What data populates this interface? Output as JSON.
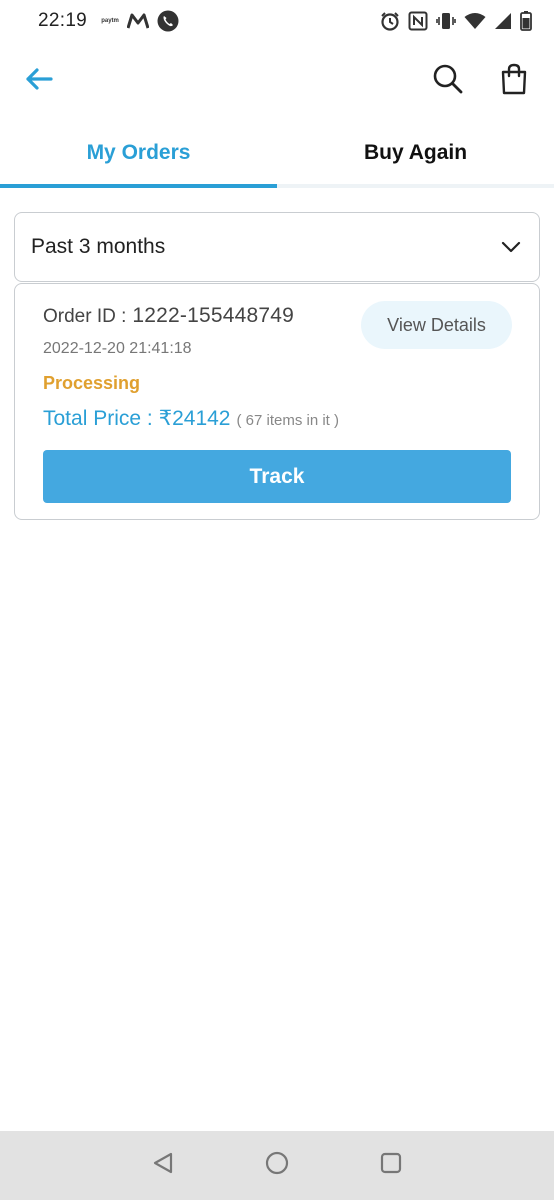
{
  "status_bar": {
    "time": "22:19",
    "left_icons": [
      "paytm-business-icon",
      "gmail-m-icon",
      "phone-call-icon"
    ],
    "paytm_text": "paytm",
    "right_icons": [
      "alarm-icon",
      "nfc-icon",
      "vibrate-icon",
      "wifi-icon",
      "signal-icon",
      "battery-icon"
    ]
  },
  "app_bar": {
    "back_icon": "arrow-left-icon",
    "search_icon": "search-icon",
    "bag_icon": "shopping-bag-icon"
  },
  "tabs": [
    {
      "label": "My Orders",
      "active": true
    },
    {
      "label": "Buy Again",
      "active": false
    }
  ],
  "filter": {
    "selected": "Past 3 months",
    "icon": "chevron-down-icon"
  },
  "orders": [
    {
      "id_label": "Order ID :",
      "id_value": "1222-155448749",
      "date": "2022-12-20 21:41:18",
      "status": "Processing",
      "price_label": "Total Price :",
      "price_value": "₹24142",
      "items_note": "( 67 items in it )",
      "view_details_label": "View Details",
      "track_label": "Track"
    }
  ],
  "colors": {
    "accent": "#2a9fd6",
    "button": "#44a8e0",
    "status_processing": "#e0a02f",
    "view_details_bg": "#eaf6fc"
  },
  "nav_bar": {
    "icons": [
      "nav-back-icon",
      "nav-home-icon",
      "nav-recents-icon"
    ]
  }
}
